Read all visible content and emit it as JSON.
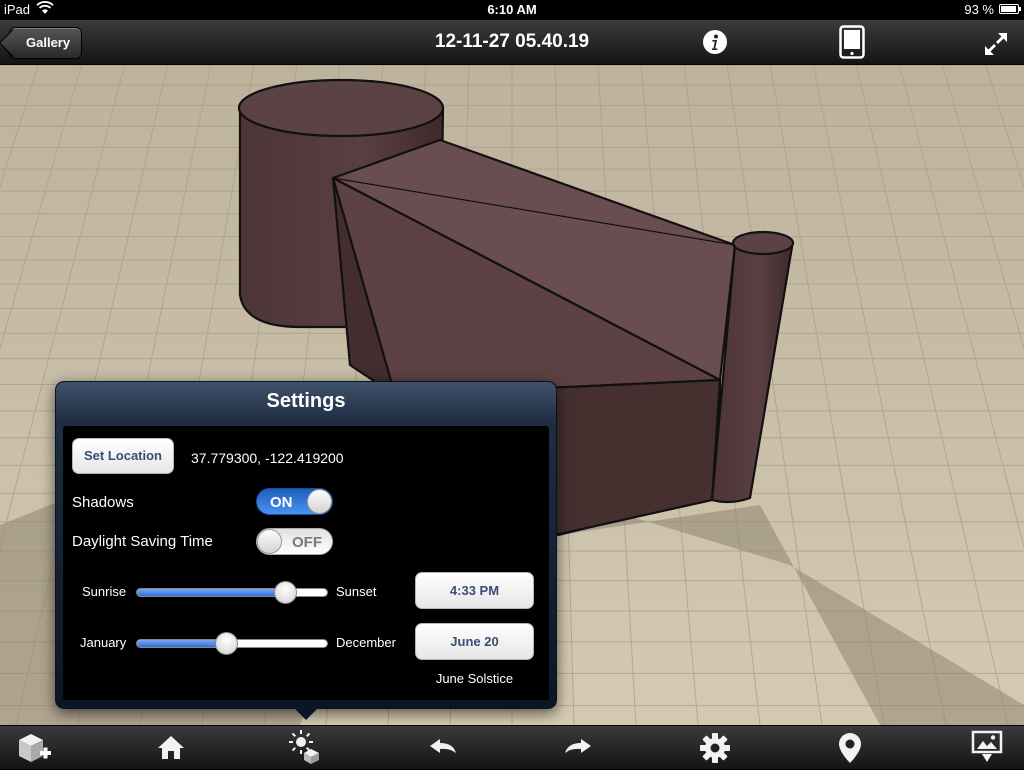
{
  "status_bar": {
    "device": "iPad",
    "time": "6:10 AM",
    "battery_percent_text": "93 %",
    "battery_level": 0.93
  },
  "nav": {
    "back_label": "Gallery",
    "title": "12-11-27 05.40.19",
    "icons": [
      "info-icon",
      "device-icon",
      "fullscreen-icon"
    ]
  },
  "settings": {
    "title": "Settings",
    "set_location_label": "Set Location",
    "coordinates": "37.779300, -122.419200",
    "shadows": {
      "label": "Shadows",
      "state": "ON",
      "on": true
    },
    "dst": {
      "label": "Daylight Saving Time",
      "state": "OFF",
      "on": false
    },
    "time_slider": {
      "min_label": "Sunrise",
      "max_label": "Sunset",
      "value": 0.78,
      "value_label": "4:33 PM"
    },
    "date_slider": {
      "min_label": "January",
      "max_label": "December",
      "value": 0.47,
      "value_label": "June 20"
    },
    "date_note": "June Solstice"
  },
  "toolbar": {
    "icons": [
      "add-model-icon",
      "home-icon",
      "sun-settings-icon",
      "undo-icon",
      "redo-icon",
      "gear-icon",
      "location-pin-icon",
      "export-image-icon"
    ]
  },
  "colors": {
    "floor": "#d1c6ae",
    "grid_line": "#b9ae97",
    "model": "#533a3d",
    "switch_on": "#2c72dd",
    "slider_fill": "#3d7fe6"
  }
}
